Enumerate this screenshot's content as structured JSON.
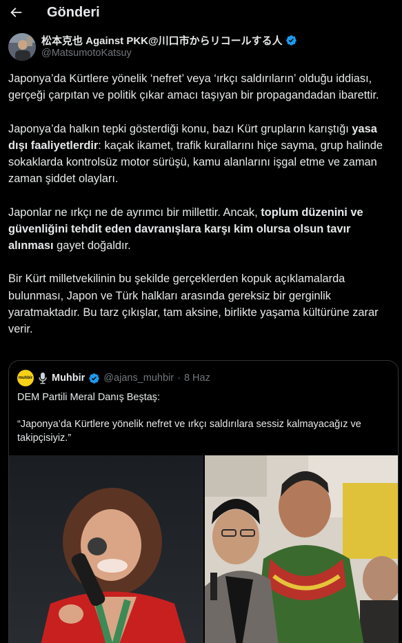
{
  "header": {
    "title": "Gönderi",
    "back_icon": "arrow-left-icon"
  },
  "author": {
    "display_name": "松本克也 Against PKK@川口市からリコールする人",
    "handle": "@MatsumotoKatsuy",
    "verified_icon": "verified-badge-icon",
    "accent_color": "#1d9bf0"
  },
  "tweet": {
    "p1": "Japonya’da Kürtlere yönelik ‘nefret’ veya ‘ırkçı saldırıların’ olduğu iddiası, gerçeği çarpıtan ve politik çıkar amacı taşıyan bir propagandadan ibarettir.",
    "p2_a": "Japonya’da halkın tepki gösterdiği konu, bazı Kürt grupların karıştığı ",
    "p2_b": "yasa dışı faaliyetlerdir",
    "p2_c": ": kaçak ikamet, trafik kurallarını hiçe sayma, grup halinde sokaklarda kontrolsüz motor sürüşü, kamu alanlarını işgal etme ve zaman zaman şiddet olayları.",
    "p3_a": "Japonlar ne ırkçı ne de ayrımcı bir millettir. Ancak, ",
    "p3_b": "toplum düzenini ve güvenliğini tehdit eden davranışlara karşı kim olursa olsun tavır alınması",
    "p3_c": " gayet doğaldır.",
    "p4": "Bir Kürt milletvekilinin bu şekilde gerçeklerden kopuk açıklamalarda bulunması, Japon ve Türk halkları arasında gereksiz bir gerginlik yaratmaktadır. Bu tarz çıkışlar, tam aksine, birlikte yaşama kültürüne zarar verir."
  },
  "quote": {
    "logo_text": "muhbir",
    "name": "Muhbir",
    "handle": "@ajans_muhbir",
    "dot": "·",
    "time": "8 Haz",
    "line1": "DEM Partili Meral Danış Beştaş:",
    "line2": "“Japonya’da Kürtlere yönelik nefret ve ırkçı saldırılara sessiz kalmayacağız ve takipçisiyiz.”",
    "logo_color": "#f7d117"
  }
}
